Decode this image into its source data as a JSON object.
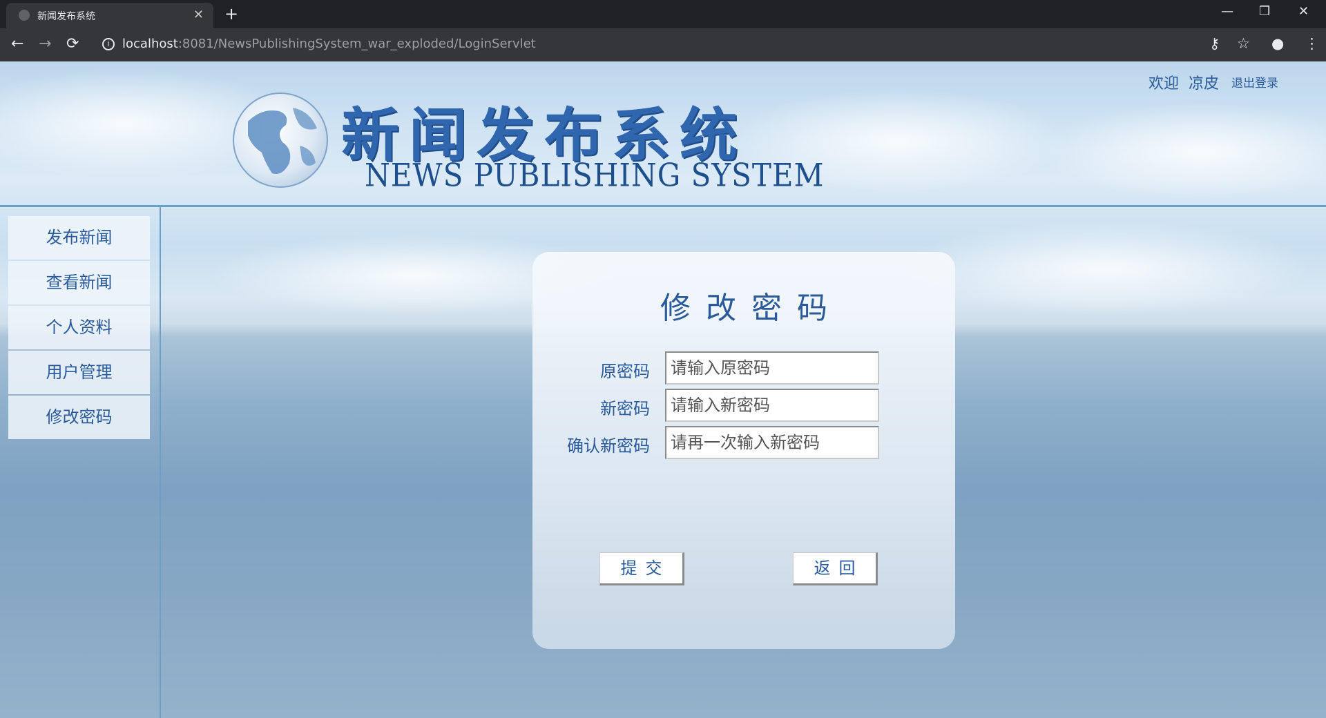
{
  "browser": {
    "tab_title": "新闻发布系统",
    "tab_close": "✕",
    "new_tab": "+",
    "url_host": "localhost",
    "url_rest": ":8081/NewsPublishingSystem_war_exploded/LoginServlet",
    "minimize": "—",
    "restore": "❐",
    "close": "✕"
  },
  "header": {
    "logo_cn": "新闻发布系统",
    "logo_en": "NEWS PUBLISHING SYSTEM",
    "welcome": "欢迎",
    "username": "凉皮",
    "logout": "退出登录"
  },
  "sidebar": {
    "items": [
      {
        "label": "发布新闻"
      },
      {
        "label": "查看新闻"
      },
      {
        "label": "个人资料"
      },
      {
        "label": "用户管理"
      },
      {
        "label": "修改密码"
      }
    ]
  },
  "form": {
    "title": "修改密码",
    "fields": [
      {
        "label": "原密码",
        "placeholder": "请输入原密码",
        "value": ""
      },
      {
        "label": "新密码",
        "placeholder": "请输入新密码",
        "value": ""
      },
      {
        "label": "确认新密码",
        "placeholder": "请再一次输入新密码",
        "value": ""
      }
    ],
    "submit_label": "提交",
    "back_label": "返回"
  },
  "colors": {
    "brand_blue": "#2a5a99",
    "chrome_dark": "#202124",
    "chrome_toolbar": "#35363a"
  }
}
